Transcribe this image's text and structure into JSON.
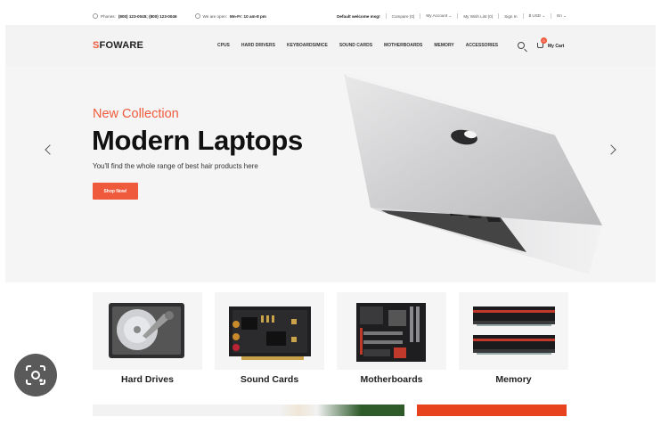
{
  "topbar": {
    "phone_prefix": "Phones:",
    "phones": "(800) 123-0045; (800) 123-0046",
    "hours_prefix": "We are open:",
    "hours": "Mn-Fr: 10 am-8 pm",
    "welcome": "Default welcome msg!",
    "compare": "Compare (0)",
    "account": "My Account",
    "wishlist": "My Wish List (0)",
    "signin": "Sign In",
    "currency": "$ USD",
    "language": "En"
  },
  "header": {
    "logo_first": "S",
    "logo_rest": "FOWARE",
    "nav": [
      "CPUS",
      "HARD DRIVERS",
      "KEYBOARDS/MICE",
      "SOUND CARDS",
      "MOTHERBOARDS",
      "MEMORY",
      "ACCESSORIES"
    ],
    "cart_count": "0",
    "cart_label": "My Cart"
  },
  "hero": {
    "subtitle": "New Collection",
    "title": "Modern Laptops",
    "description": "You'll find the whole range of best hair products here",
    "cta": "Shop Now!"
  },
  "categories": [
    {
      "label": "Hard Drives",
      "icon": "hard-drive-icon"
    },
    {
      "label": "Sound Cards",
      "icon": "sound-card-icon"
    },
    {
      "label": "Motherboards",
      "icon": "motherboard-icon"
    },
    {
      "label": "Memory",
      "icon": "memory-icon"
    }
  ],
  "colors": {
    "accent": "#f05a3c",
    "hero_bg": "#f5f5f5"
  }
}
